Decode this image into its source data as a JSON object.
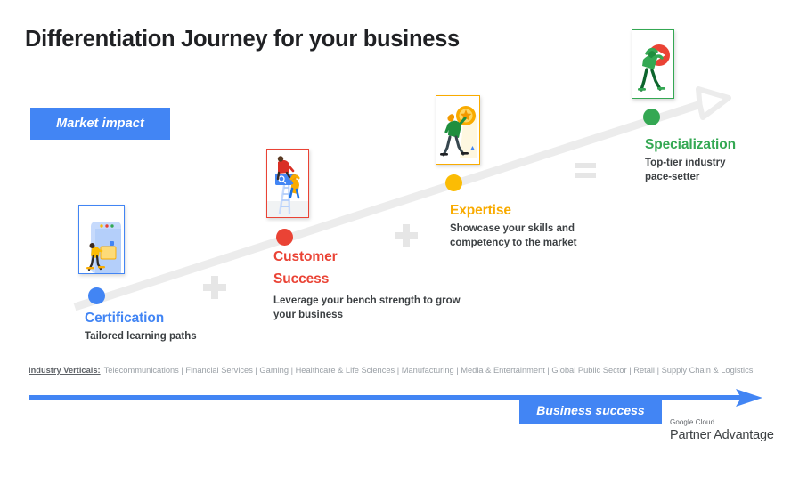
{
  "slide": {
    "title": "Differentiation Journey for your business",
    "market_badge": "Market impact",
    "business_badge": "Business success"
  },
  "colors": {
    "blue": "#4285f4",
    "red": "#ea4335",
    "yellow": "#fbbc04",
    "green": "#34a853",
    "orange_title": "#f9ab00",
    "grey_operator": "#e6e6e6",
    "track": "#ececec"
  },
  "stages": [
    {
      "key": "certification",
      "title": "Certification",
      "desc": "Tailored learning paths",
      "color": "#4285f4",
      "illustration": "person-pushing-box-illustration"
    },
    {
      "key": "customer-success",
      "title": "Customer Success",
      "title_line1": "Customer",
      "title_line2": "Success",
      "desc": "Leverage your bench strength to grow your business",
      "desc_line1": "Leverage your bench strength to grow",
      "desc_line2": "your business",
      "color": "#ea4335",
      "illustration": "people-on-ladder-illustration"
    },
    {
      "key": "expertise",
      "title": "Expertise",
      "desc": "Showcase your skills and competency to the market",
      "desc_line1": "Showcase your skills and",
      "desc_line2": "competency to the market",
      "color": "#f9ab00",
      "illustration": "person-holding-medal-illustration"
    },
    {
      "key": "specialization",
      "title": "Specialization",
      "desc": "Top-tier industry pace-setter",
      "desc_line1": "Top-tier industry",
      "desc_line2": "pace-setter",
      "color": "#34a853",
      "illustration": "person-carrying-play-button-illustration"
    }
  ],
  "operators": [
    {
      "key": "plus-1",
      "symbol": "+"
    },
    {
      "key": "plus-2",
      "symbol": "+"
    },
    {
      "key": "equals",
      "symbol": "="
    }
  ],
  "verticals": {
    "label": "Industry Verticals:",
    "items": [
      "Telecommunications",
      "Financial Services",
      "Gaming",
      "Healthcare & Life Sciences",
      "Manufacturing",
      "Media & Entertainment",
      "Global Public Sector",
      "Retail",
      "Supply Chain & Logistics"
    ],
    "text": "Telecommunications | Financial Services | Gaming | Healthcare & Life Sciences | Manufacturing | Media & Entertainment | Global Public Sector | Retail | Supply Chain & Logistics"
  },
  "logo": {
    "top": "Google Cloud",
    "bottom": "Partner Advantage"
  }
}
